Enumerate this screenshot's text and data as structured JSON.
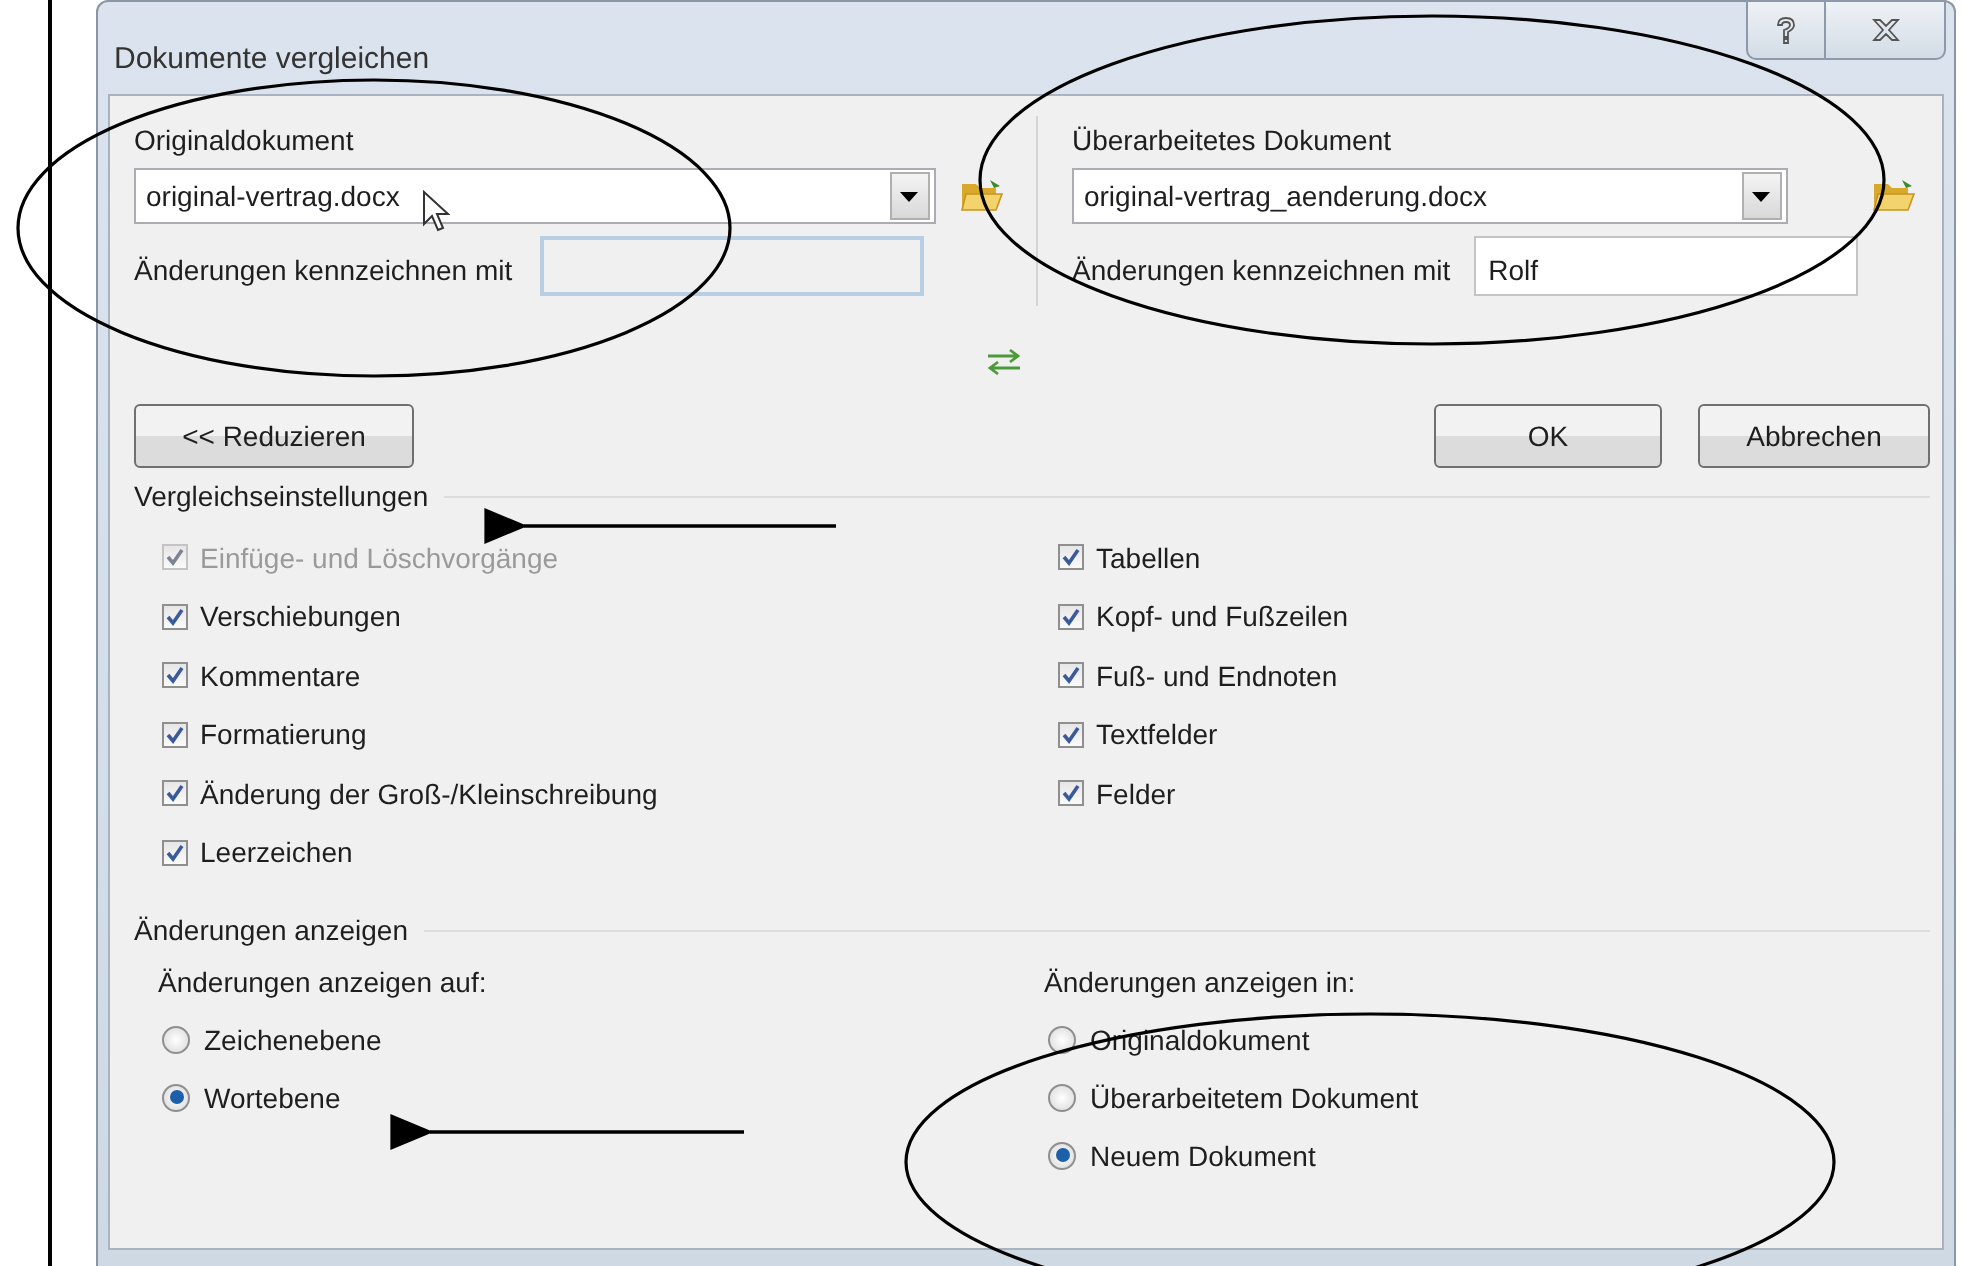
{
  "window": {
    "title": "Dokumente vergleichen"
  },
  "documents": [
    {
      "label": "Originaldokument",
      "file": "original-vertrag.docx",
      "mark_label": "Änderungen kennzeichnen mit",
      "mark_disabled": true
    },
    {
      "label": "Überarbeitetes Dokument",
      "file": "original-vertrag_aenderung.docx",
      "mark_label": "Änderungen kennzeichnen mit",
      "mark_value": "Rolf",
      "mark_disabled": false
    }
  ],
  "reduce_button": "<< Reduzieren",
  "ok_button": "OK",
  "cancel_button": "Abbrechen",
  "comparison_settings": {
    "title": "Vergleichseinstellungen",
    "options": [
      {
        "label": "Einfüge- und Löschvorgänge",
        "checked": true,
        "disabled": true
      },
      {
        "label": "Verschiebungen",
        "checked": true,
        "disabled": false
      },
      {
        "label": "Kommentare",
        "checked": true,
        "disabled": false
      },
      {
        "label": "Formatierung",
        "checked": true,
        "disabled": false
      },
      {
        "label": "Änderung der Groß-/Kleinschreibung",
        "checked": true,
        "disabled": false
      },
      {
        "label": "Leerzeichen",
        "checked": true,
        "disabled": false
      },
      {
        "label": "Tabellen",
        "checked": true,
        "disabled": false
      },
      {
        "label": "Kopf- und Fußzeilen",
        "checked": true,
        "disabled": false
      },
      {
        "label": "Fuß- und Endnoten",
        "checked": true,
        "disabled": false
      },
      {
        "label": "Textfelder",
        "checked": true,
        "disabled": false
      },
      {
        "label": "Felder",
        "checked": true,
        "disabled": false
      }
    ]
  },
  "show_changes": {
    "title": "Änderungen anzeigen",
    "groups": [
      {
        "title": "Änderungen anzeigen auf:",
        "options": [
          {
            "label": "Zeichenebene",
            "selected": false
          },
          {
            "label": "Wortebene",
            "selected": true
          }
        ]
      },
      {
        "title": "Änderungen anzeigen in:",
        "options": [
          {
            "label": "Originaldokument",
            "selected": false
          },
          {
            "label": "Überarbeitetem Dokument",
            "selected": false
          },
          {
            "label": "Neuem Dokument",
            "selected": true
          }
        ]
      }
    ]
  }
}
